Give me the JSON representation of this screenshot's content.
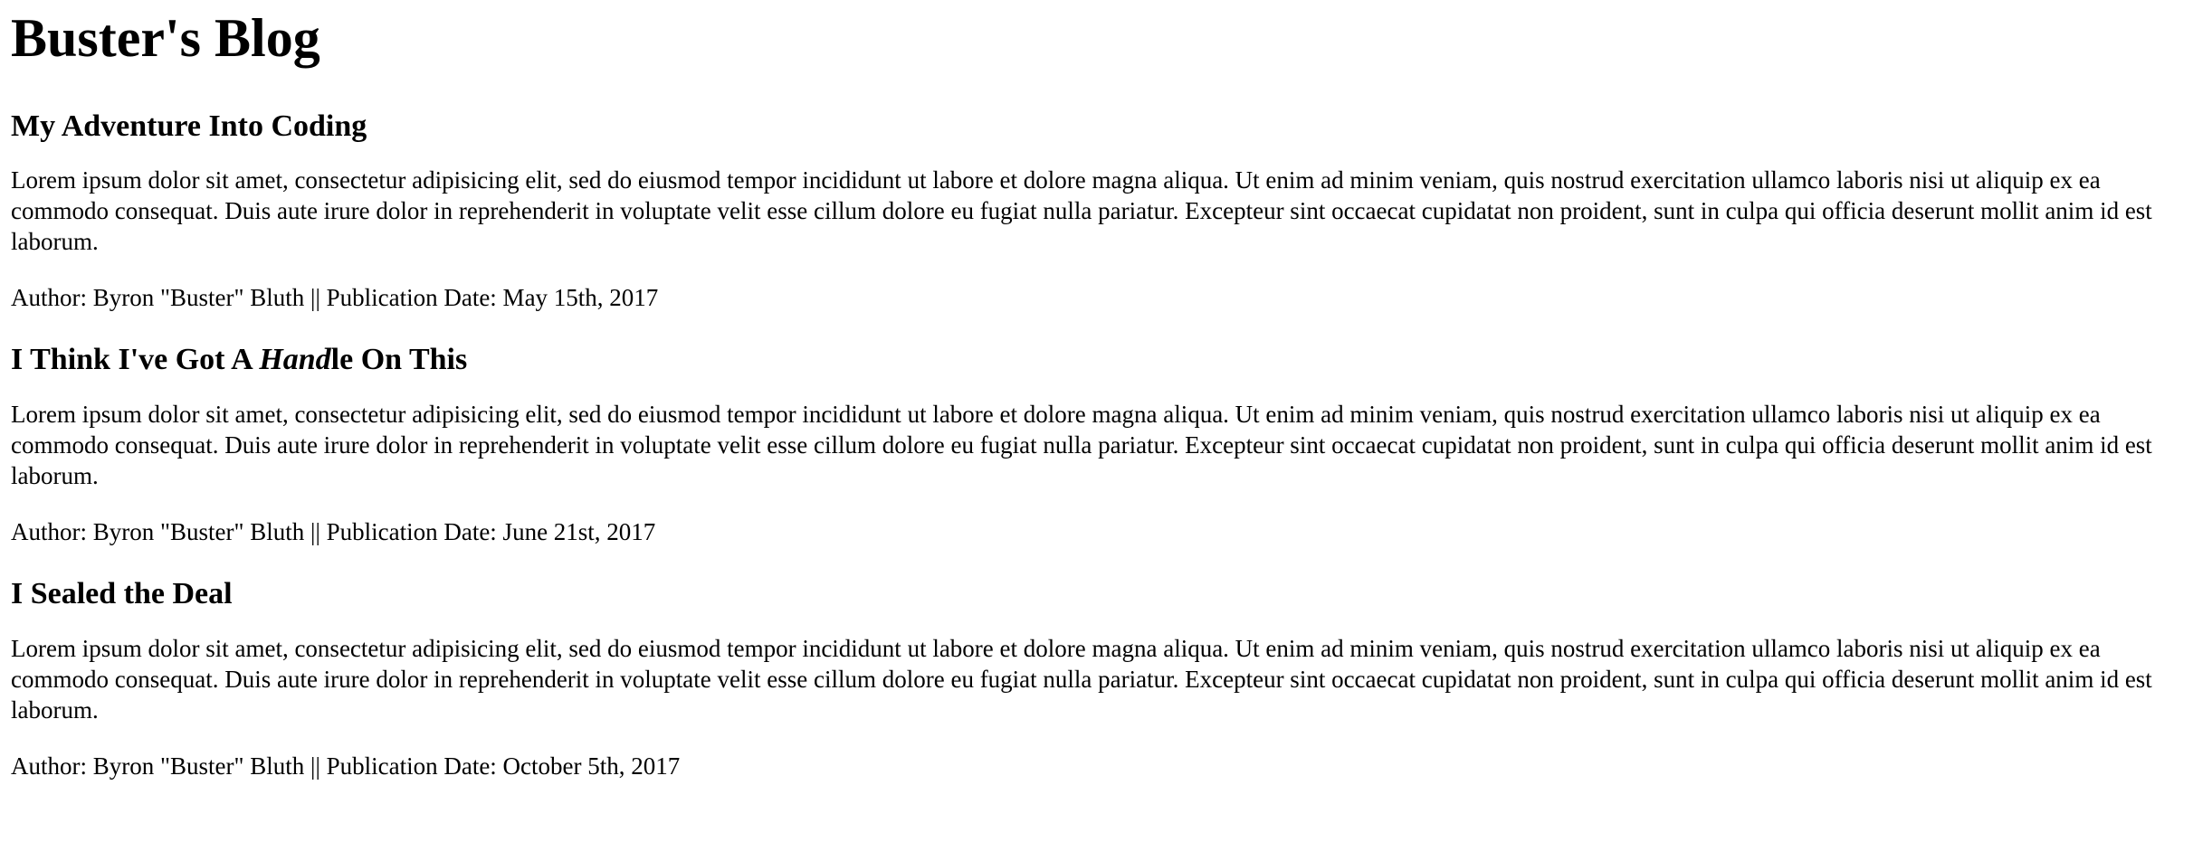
{
  "blog": {
    "title": "Buster's Blog"
  },
  "posts": [
    {
      "title": "My Adventure Into Coding",
      "body": "Lorem ipsum dolor sit amet, consectetur adipisicing elit, sed do eiusmod tempor incididunt ut labore et dolore magna aliqua. Ut enim ad minim veniam, quis nostrud exercitation ullamco laboris nisi ut aliquip ex ea commodo consequat. Duis aute irure dolor in reprehenderit in voluptate velit esse cillum dolore eu fugiat nulla pariatur. Excepteur sint occaecat cupidatat non proident, sunt in culpa qui officia deserunt mollit anim id est laborum.",
      "meta": "Author: Byron \"Buster\" Bluth || Publication Date: May 15th, 2017"
    },
    {
      "title_before": "I Think I've Got A ",
      "title_emphasis": "Hand",
      "title_after": "le On This",
      "body": "Lorem ipsum dolor sit amet, consectetur adipisicing elit, sed do eiusmod tempor incididunt ut labore et dolore magna aliqua. Ut enim ad minim veniam, quis nostrud exercitation ullamco laboris nisi ut aliquip ex ea commodo consequat. Duis aute irure dolor in reprehenderit in voluptate velit esse cillum dolore eu fugiat nulla pariatur. Excepteur sint occaecat cupidatat non proident, sunt in culpa qui officia deserunt mollit anim id est laborum.",
      "meta": "Author: Byron \"Buster\" Bluth || Publication Date: June 21st, 2017"
    },
    {
      "title": "I Sealed the Deal",
      "body": "Lorem ipsum dolor sit amet, consectetur adipisicing elit, sed do eiusmod tempor incididunt ut labore et dolore magna aliqua. Ut enim ad minim veniam, quis nostrud exercitation ullamco laboris nisi ut aliquip ex ea commodo consequat. Duis aute irure dolor in reprehenderit in voluptate velit esse cillum dolore eu fugiat nulla pariatur. Excepteur sint occaecat cupidatat non proident, sunt in culpa qui officia deserunt mollit anim id est laborum.",
      "meta": "Author: Byron \"Buster\" Bluth || Publication Date: October 5th, 2017"
    }
  ]
}
